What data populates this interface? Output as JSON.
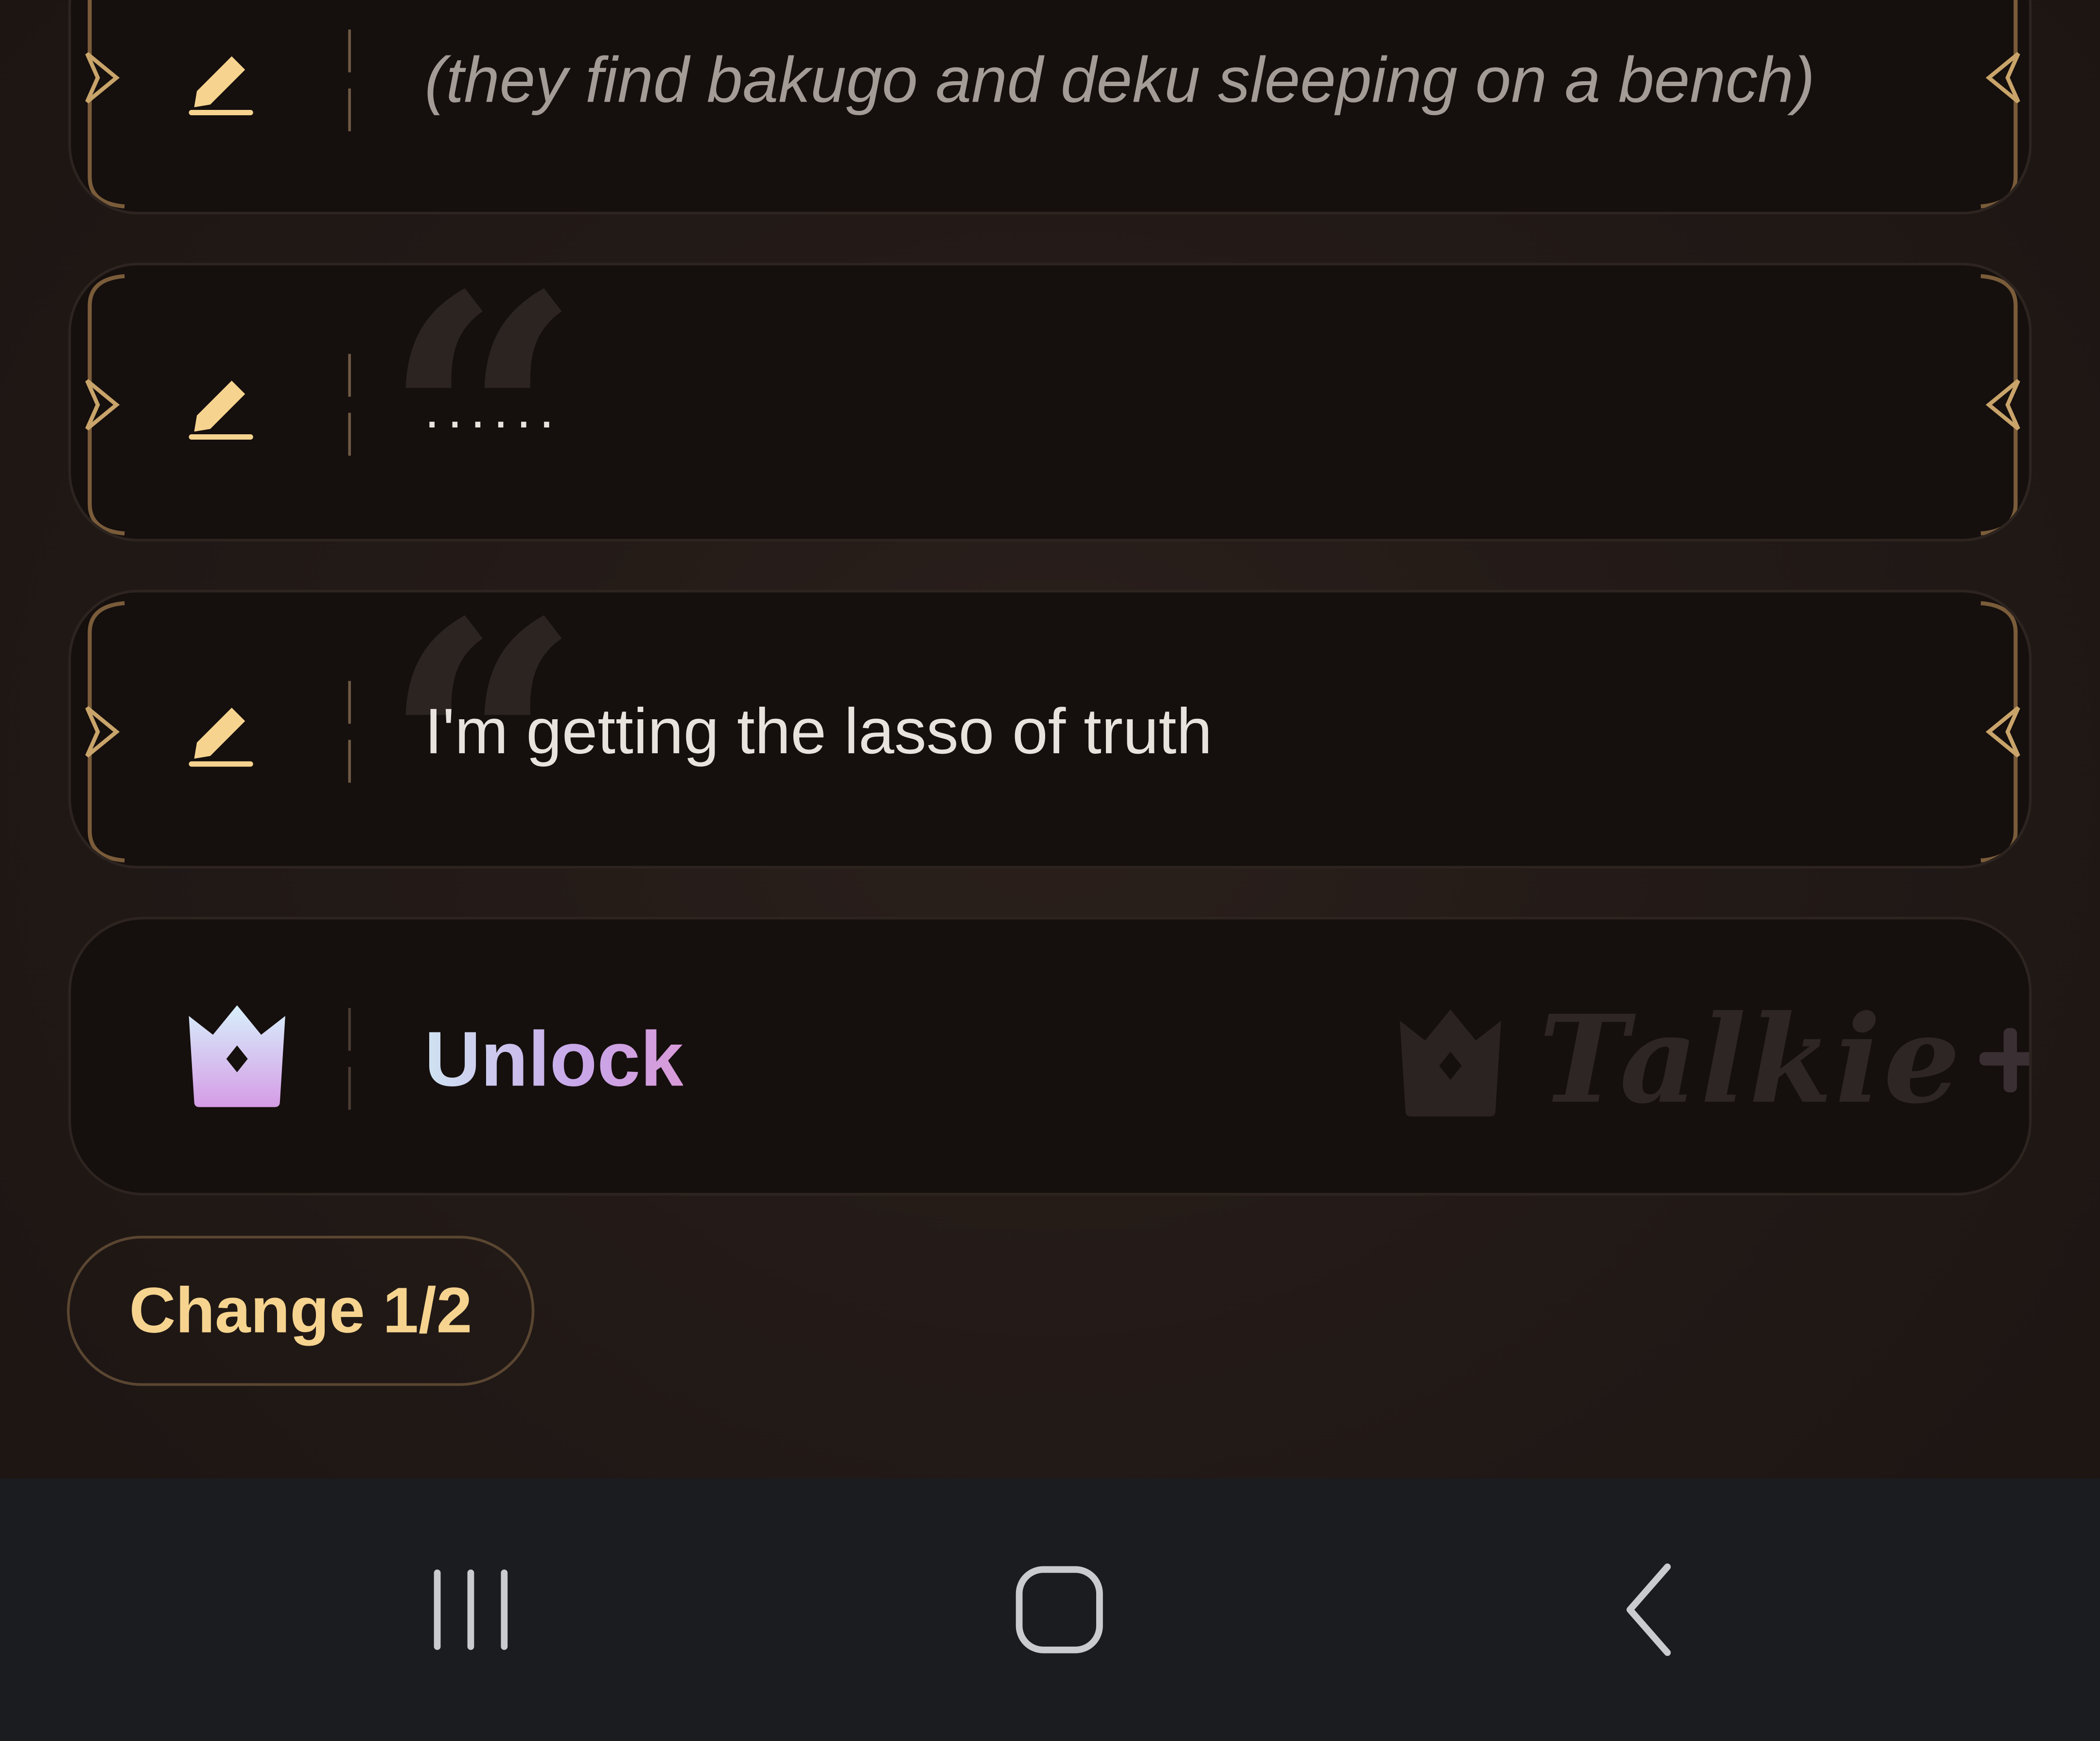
{
  "messages": [
    {
      "text": "(they find bakugo and deku sleeping on a bench)",
      "style": "italic"
    },
    {
      "text": "......",
      "style": "dots"
    },
    {
      "text": "I'm getting the lasso of truth",
      "style": "normal"
    }
  ],
  "unlock": {
    "label": "Unlock",
    "watermark_brand": "Talkie"
  },
  "change_button": {
    "label": "Change 1/2"
  },
  "navbar": {
    "recents_icon": "recents-icon",
    "home_icon": "home-icon",
    "back_icon": "back-icon"
  },
  "colors": {
    "accent_gold": "#f6d48f",
    "card_bg": "#150f0d",
    "navbar_bg": "#1b1c20"
  }
}
